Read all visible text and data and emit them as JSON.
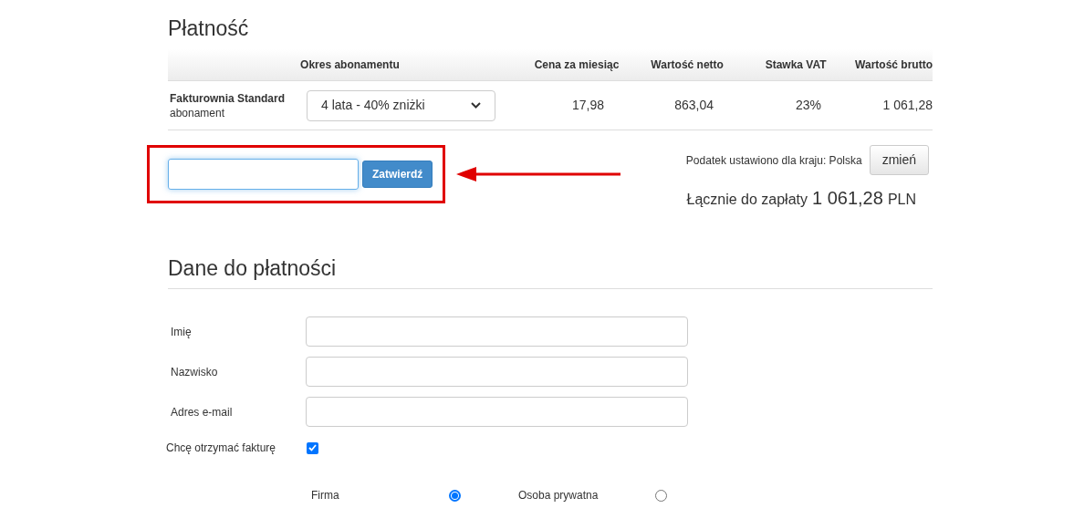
{
  "payment": {
    "heading": "Płatność",
    "table": {
      "columns": [
        "Okres abonamentu",
        "Cena za miesiąc",
        "Wartość netto",
        "Stawka VAT",
        "Wartość brutto"
      ],
      "row": {
        "product": "Fakturownia Standard",
        "note": "abonament",
        "period": "4 lata - 40% zniżki",
        "cells": [
          "17,98",
          "863,04",
          "23%",
          "1 061,28"
        ]
      }
    },
    "coupon": {
      "button": "Zatwierdź"
    },
    "tax": {
      "note": "Podatek ustawiono dla kraju: Polska",
      "button": "zmień"
    },
    "total": {
      "label": "Łącznie do zapłaty",
      "amount": "1 061,28",
      "currency": "PLN"
    }
  },
  "billing": {
    "heading": "Dane do płatności",
    "fields": [
      {
        "label": "Imię"
      },
      {
        "label": "Nazwisko"
      },
      {
        "label": "Adres e-mail"
      }
    ],
    "invoice": {
      "label": "Chcę otrzymać fakturę",
      "checked": true
    },
    "customer_type": [
      {
        "label": "Firma",
        "selected": true
      },
      {
        "label": "Osoba prywatna",
        "selected": false
      }
    ]
  }
}
